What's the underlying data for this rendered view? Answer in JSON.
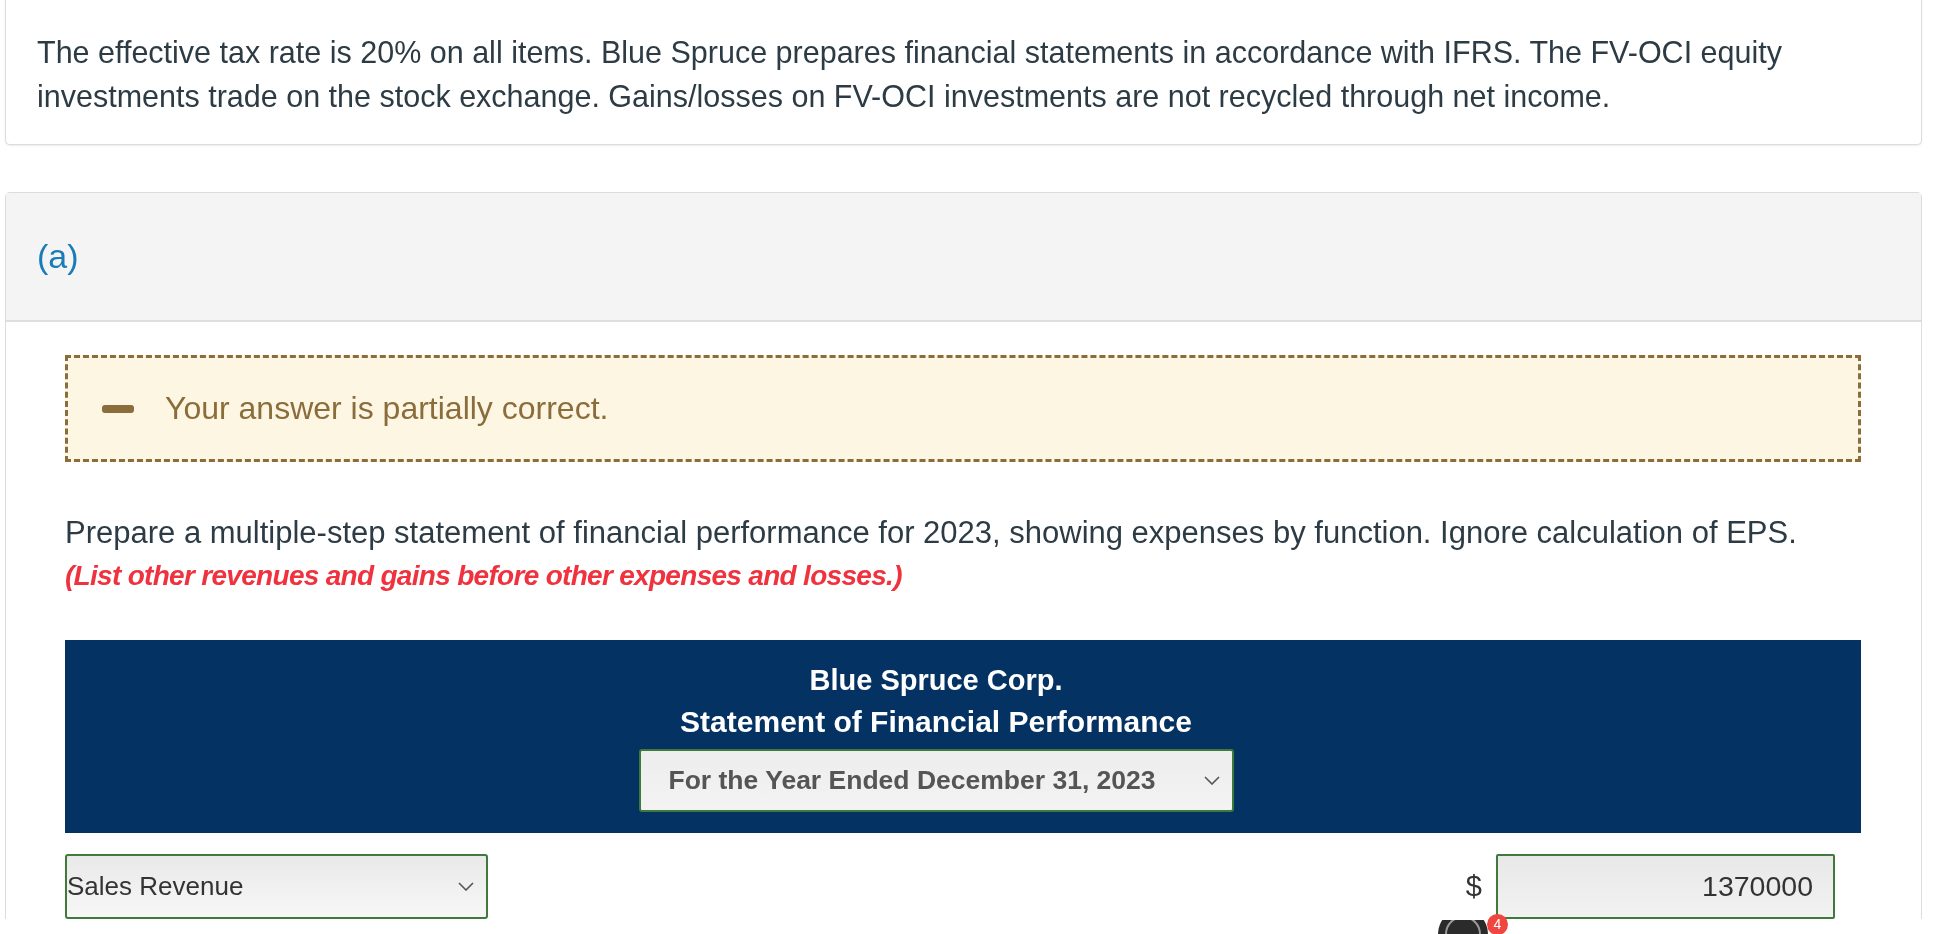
{
  "intro": {
    "text": "The effective tax rate is 20% on all items. Blue Spruce prepares financial statements in accordance with IFRS. The FV-OCI equity investments trade on the stock exchange. Gains/losses on FV-OCI investments are not recycled through net income."
  },
  "part": {
    "label": "(a)",
    "feedback": {
      "kind": "partial",
      "message": "Your answer is partially correct."
    },
    "instructions": {
      "text": "Prepare a multiple-step statement of financial performance for 2023, showing expenses by function. Ignore calculation of EPS.",
      "note": "(List other revenues and gains before other expenses and losses.)"
    },
    "statement_header": {
      "company": "Blue Spruce Corp.",
      "title": "Statement of Financial Performance",
      "period_select": {
        "value": "For the Year Ended December 31, 2023"
      }
    },
    "rows": [
      {
        "account_select": {
          "value": "Sales Revenue"
        },
        "currency": "$",
        "amount": {
          "value": "1370000"
        }
      }
    ]
  },
  "floating_widget": {
    "badge": "4"
  }
}
